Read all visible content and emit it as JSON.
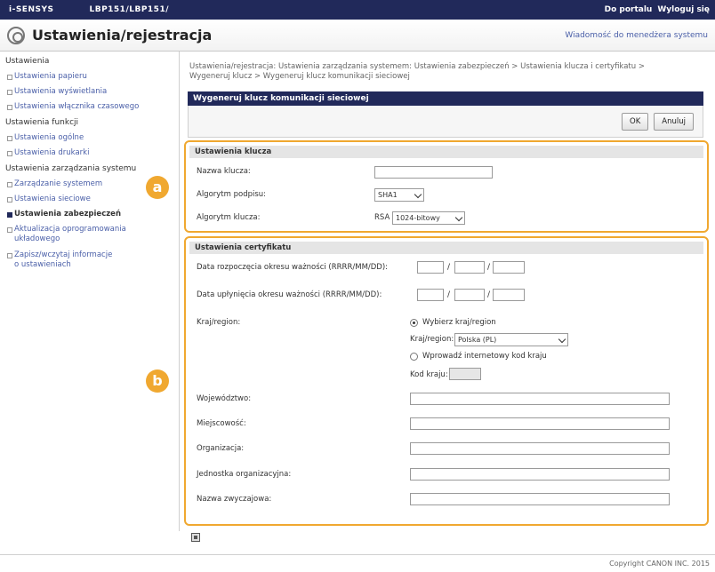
{
  "topbar": {
    "brand": "i-SENSYS",
    "model": "LBP151/LBP151/",
    "portal_link": "Do portalu",
    "logout_link": "Wyloguj się"
  },
  "header": {
    "title": "Ustawienia/rejestracja",
    "mail_link": "Wiadomość do menedżera systemu"
  },
  "sidebar": {
    "groups": [
      {
        "label": "Ustawienia",
        "items": [
          "Ustawienia papieru",
          "Ustawienia wyświetlania",
          "Ustawienia włącznika czasowego"
        ]
      },
      {
        "label": "Ustawienia funkcji",
        "items": [
          "Ustawienia ogólne",
          "Ustawienia drukarki"
        ]
      },
      {
        "label": "Ustawienia zarządzania systemu",
        "items": [
          "Zarządzanie systemem",
          "Ustawienia sieciowe",
          "Ustawienia zabezpieczeń",
          "Aktualizacja oprogramowania układowego",
          "Zapisz/wczytaj informacje o ustawieniach"
        ]
      }
    ]
  },
  "breadcrumb": "Ustawienia/rejestracja: Ustawienia zarządzania systemem: Ustawienia zabezpieczeń > Ustawienia klucza i certyfikatu > Wygeneruj klucz > Wygeneruj klucz komunikacji sieciowej",
  "panel": {
    "title": "Wygeneruj klucz komunikacji sieciowej",
    "ok_label": "OK",
    "cancel_label": "Anuluj"
  },
  "key_settings": {
    "heading": "Ustawienia klucza",
    "key_name_label": "Nazwa klucza:",
    "key_name_value": "",
    "signature_label": "Algorytm podpisu:",
    "signature_value": "SHA1",
    "key_algorithm_label": "Algorytm klucza:",
    "key_algorithm_prefix": "RSA",
    "key_algorithm_value": "1024-bitowy"
  },
  "cert_settings": {
    "heading": "Ustawienia certyfikatu",
    "valid_from_label": "Data rozpoczęcia okresu ważności (RRRR/MM/DD):",
    "valid_to_label": "Data upłynięcia okresu ważności (RRRR/MM/DD):",
    "date_sep": "/",
    "country_label": "Kraj/region:",
    "choose_country_label": "Wybierz kraj/region",
    "country_select_label": "Kraj/region:",
    "country_select_value": "Polska (PL)",
    "enter_code_label": "Wprowadź internetowy kod kraju",
    "country_code_label": "Kod kraju:",
    "state_label": "Województwo:",
    "city_label": "Miejscowość:",
    "org_label": "Organizacja:",
    "org_unit_label": "Jednostka organizacyjna:",
    "common_name_label": "Nazwa zwyczajowa:"
  },
  "badges": {
    "a": "a",
    "b": "b"
  },
  "footer": {
    "copyright": "Copyright CANON INC. 2015"
  },
  "colors": {
    "topbar": "#21295a",
    "highlight": "#f0a830",
    "link": "#4a5fa8"
  }
}
